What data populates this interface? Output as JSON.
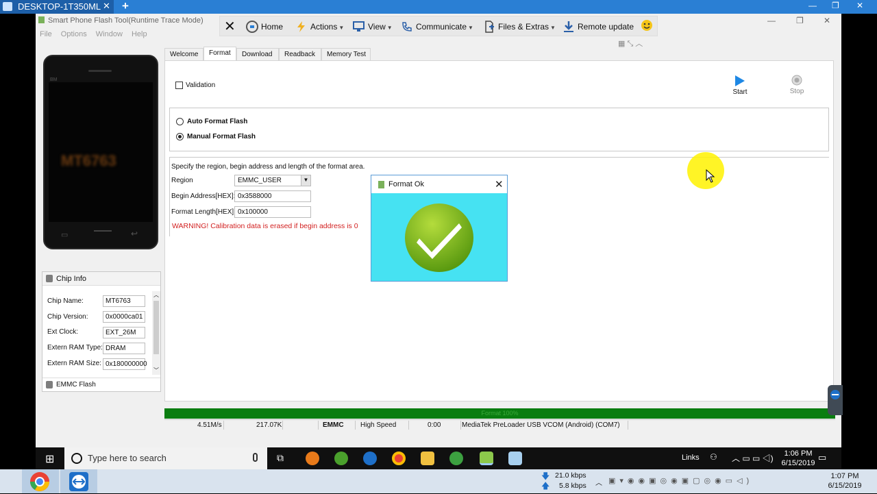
{
  "remote": {
    "tab_title": "DESKTOP-1T350ML",
    "close": "✕",
    "plus": "+"
  },
  "app": {
    "title": "Smart Phone Flash Tool(Runtime Trace Mode)",
    "menu": [
      "File",
      "Options",
      "Window",
      "Help"
    ],
    "toolbar": {
      "home": "Home",
      "actions": "Actions",
      "view": "View",
      "communicate": "Communicate",
      "files": "Files & Extras",
      "remote_update": "Remote update"
    },
    "tabs": [
      "Welcome",
      "Format",
      "Download",
      "Readback",
      "Memory Test"
    ],
    "active_tab": "Format",
    "validation_label": "Validation",
    "start_label": "Start",
    "stop_label": "Stop",
    "auto_format": "Auto Format Flash",
    "manual_format": "Manual Format Flash",
    "region_desc": "Specify the region, begin address and length of the format area.",
    "region_label": "Region",
    "region_value": "EMMC_USER",
    "begin_label": "Begin Address[HEX]:",
    "begin_value": "0x3588000",
    "length_label": "Format Length[HEX]:",
    "length_value": "0x100000",
    "warning": "WARNING! Calibration data is erased if begin address is 0"
  },
  "phone": {
    "chip": "MT6763",
    "brand": "BM"
  },
  "chip_info": {
    "title": "Chip Info",
    "rows": [
      {
        "label": "Chip Name:",
        "value": "MT6763"
      },
      {
        "label": "Chip Version:",
        "value": "0x0000ca01"
      },
      {
        "label": "Ext Clock:",
        "value": "EXT_26M"
      },
      {
        "label": "Extern RAM Type:",
        "value": "DRAM"
      },
      {
        "label": "Extern RAM Size:",
        "value": "0x180000000"
      }
    ],
    "emmc": "EMMC Flash"
  },
  "progress": {
    "text": "Format 100%",
    "fraction": 1.0
  },
  "status": {
    "speed": "4.51M/s",
    "size": "217.07K",
    "storage": "EMMC",
    "mode": "High Speed",
    "time": "0:00",
    "port": "MediaTek PreLoader USB VCOM (Android) (COM7)"
  },
  "dialog": {
    "title": "Format Ok"
  },
  "taskbar_remote": {
    "search_placeholder": "Type here to search",
    "links": "Links",
    "time": "1:06 PM",
    "date": "6/15/2019"
  },
  "taskbar_local": {
    "down": "21.0 kbps",
    "up": "5.8 kbps",
    "time": "1:07 PM",
    "date": "6/15/2019"
  },
  "colors": {
    "progress": "#0a7d10",
    "dialog_bg": "#46e2f2",
    "check": "#7cb518",
    "warning": "#d22020",
    "accent": "#2a7fd4"
  }
}
